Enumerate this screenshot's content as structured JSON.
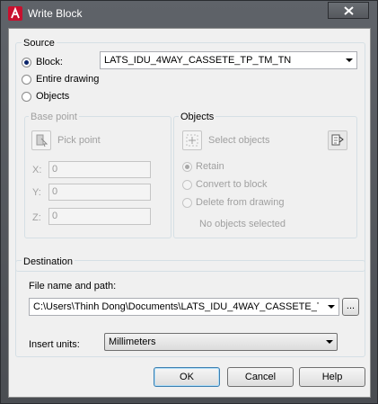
{
  "window": {
    "title": "Write Block",
    "close_icon": "close-icon",
    "app_icon": "autocad-icon"
  },
  "source": {
    "label": "Source",
    "options": [
      {
        "label": "Block:",
        "selected": true
      },
      {
        "label": "Entire drawing",
        "selected": false
      },
      {
        "label": "Objects",
        "selected": false
      }
    ],
    "block_value": "LATS_IDU_4WAY_CASSETE_TP_TM_TN"
  },
  "base_point": {
    "label": "Base point",
    "pick_label": "Pick point",
    "x_label": "X:",
    "x_value": "0",
    "y_label": "Y:",
    "y_value": "0",
    "z_label": "Z:",
    "z_value": "0"
  },
  "objects": {
    "label": "Objects",
    "select_label": "Select objects",
    "options": [
      {
        "label": "Retain",
        "selected": true
      },
      {
        "label": "Convert to block",
        "selected": false
      },
      {
        "label": "Delete from drawing",
        "selected": false
      }
    ],
    "status": "No objects selected"
  },
  "destination": {
    "label": "Destination",
    "file_label": "File name and path:",
    "file_value": "C:\\Users\\Thinh Dong\\Documents\\LATS_IDU_4WAY_CASSETE_T",
    "browse_label": "...",
    "units_label": "Insert units:",
    "units_value": "Millimeters"
  },
  "buttons": {
    "ok": "OK",
    "cancel": "Cancel",
    "help": "Help"
  },
  "colors": {
    "titlebar": "#5a5d63",
    "dialog_bg": "#f0f0f0",
    "radio_selected": "#0a246a"
  }
}
